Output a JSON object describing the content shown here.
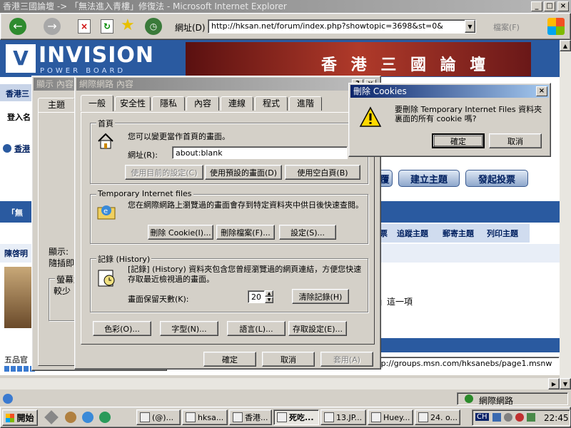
{
  "window": {
    "title": "香港三國論壇 -> 「無法進入青樓」修復法 - Microsoft Internet Explorer",
    "controls": [
      "_",
      "□",
      "×"
    ]
  },
  "toolbar": {
    "address_label": "網址(D)",
    "url": "http://hksan.net/forum/index.php?showtopic=3698&st=0&",
    "links_label": "檔案(F)"
  },
  "forum": {
    "logo_main": "INVISION",
    "logo_sub": "POWER BOARD",
    "banner_text": "香 港 三 國 論 壇",
    "side_items": [
      "香港三",
      "登入名",
      "香港"
    ],
    "breadcrumb_partial": "「無",
    "reply_btn": "覆",
    "new_topic_btn": "建立主題",
    "new_poll_btn": "發起投票",
    "topic_links": [
      "票",
      "追蹤主題",
      "郵寄主題",
      "列印主題"
    ],
    "author": "陳啓明",
    "post_text": "」這一項",
    "footer_author": "五品官",
    "status_url": "ttp://groups.msn.com/hksanebs/page1.msnw"
  },
  "behind_dialog": {
    "title": "顯示 內容",
    "tab": "主題",
    "text1": "顯示:",
    "text2": "隨插即用",
    "group_label": "螢幕解",
    "group_text": "較少"
  },
  "options_dialog": {
    "title": "網際網路 內容",
    "tabs": [
      "一般",
      "安全性",
      "隱私",
      "內容",
      "連線",
      "程式",
      "進階"
    ],
    "homepage": {
      "group": "首頁",
      "desc": "您可以變更當作首頁的畫面。",
      "address_label": "網址(R):",
      "address_value": "about:blank",
      "btn_current": "使用目前的設定(C)",
      "btn_default": "使用預設的畫面(D)",
      "btn_blank": "使用空白頁(B)"
    },
    "temp_files": {
      "group": "Temporary Internet files",
      "desc": "您在網際網路上瀏覽過的畫面會存到特定資料夾中供日後快速查閱。",
      "btn_cookies": "刪除 Cookie(I)...",
      "btn_files": "刪除檔案(F)...",
      "btn_settings": "設定(S)..."
    },
    "history": {
      "group": "記錄 (History)",
      "desc": "[記錄] (History) 資料夾包含您曾經瀏覽過的網頁連結，方便您快速存取最近檢視過的畫面。",
      "days_label": "畫面保留天數(K):",
      "days_value": "20",
      "btn_clear": "清除記錄(H)"
    },
    "bottom_buttons": [
      "色彩(O)...",
      "字型(N)...",
      "語言(L)...",
      "存取設定(E)..."
    ],
    "ok": "確定",
    "cancel": "取消",
    "apply": "套用(A)"
  },
  "cookie_dialog": {
    "title": "刪除 Cookies",
    "message": "要刪除 Temporary Internet Files 資料夾裏面的所有 cookie 嗎?",
    "ok": "確定",
    "cancel": "取消"
  },
  "statusbar": {
    "zone": "網際網路"
  },
  "taskbar": {
    "start": "開始",
    "tasks": [
      "(@)...",
      "hksa...",
      "香港...",
      "死吃...",
      "13.JP...",
      "Huey...",
      "24. o..."
    ],
    "tray_lang": "CH",
    "clock": "22:45"
  },
  "colors": {
    "title_active": "#0a246a",
    "title_gradient_end": "#a6caf0",
    "face": "#d4d0c8",
    "forum_blue": "#1a4a8a",
    "banner_red": "#8b1a1a"
  }
}
